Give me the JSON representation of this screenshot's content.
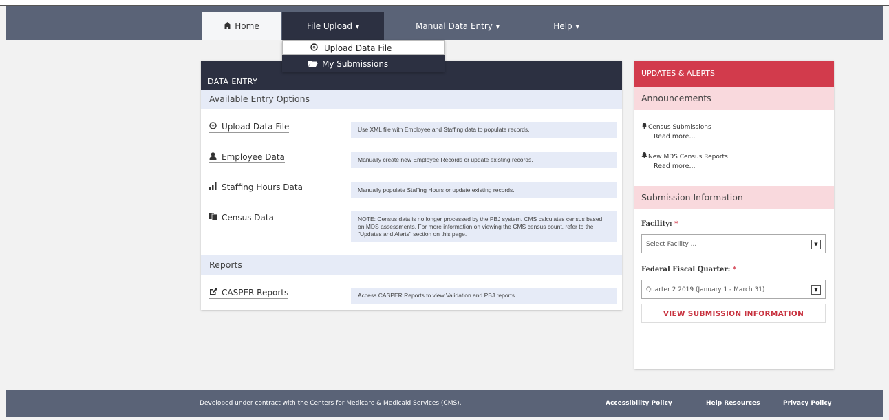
{
  "nav": {
    "home": "Home",
    "file_upload": "File Upload",
    "manual_entry": "Manual Data Entry",
    "help": "Help",
    "caret": "▾"
  },
  "dropdown": {
    "upload": "Upload Data File",
    "submissions": "My Submissions"
  },
  "data_entry": {
    "title": "DATA ENTRY",
    "available_title": "Available Entry Options",
    "entries": [
      {
        "label": "Upload Data File",
        "icon": "upload-circle-icon",
        "desc": "Use XML file with Employee and Staffing data to populate records."
      },
      {
        "label": "Employee Data",
        "icon": "user-icon",
        "desc": "Manually create new Employee Records or update existing records."
      },
      {
        "label": "Staffing Hours Data",
        "icon": "bar-chart-icon",
        "desc": "Manually populate Staffing Hours or update existing records."
      },
      {
        "label": "Census Data",
        "icon": "documents-icon",
        "desc": "NOTE: Census data is no longer processed by the PBJ system. CMS calculates census based on MDS assessments. For more information on viewing the CMS census count, refer to the \"Updates and Alerts\" section on this page."
      }
    ],
    "reports_title": "Reports",
    "casper": {
      "label": "CASPER Reports",
      "icon": "external-link-icon",
      "desc": "Access CASPER Reports to view Validation and PBJ reports."
    }
  },
  "updates": {
    "title": "UPDATES & ALERTS",
    "announcements_title": "Announcements",
    "announcements": [
      {
        "title": "Census Submissions",
        "read_more": "Read more..."
      },
      {
        "title": "New MDS Census Reports",
        "read_more": "Read more..."
      }
    ],
    "submission_title": "Submission Information",
    "facility_label": "Facility:",
    "facility_value": "Select Facility ...",
    "quarter_label": "Federal Fiscal Quarter:",
    "quarter_value": "Quarter 2 2019 (January 1 - March 31)",
    "required_mark": "*",
    "view_button": "VIEW SUBMISSION INFORMATION"
  },
  "footer": {
    "text": "Developed under contract with the Centers for Medicare & Medicaid Services (CMS).",
    "accessibility": "Accessibility Policy",
    "help": "Help Resources",
    "privacy": "Privacy Policy"
  },
  "colors": {
    "navbar": "#5a6377",
    "dark": "#2c3041",
    "alert": "#d23b4c",
    "light_blue": "#e6ebf7",
    "light_pink": "#f9d9dd"
  }
}
